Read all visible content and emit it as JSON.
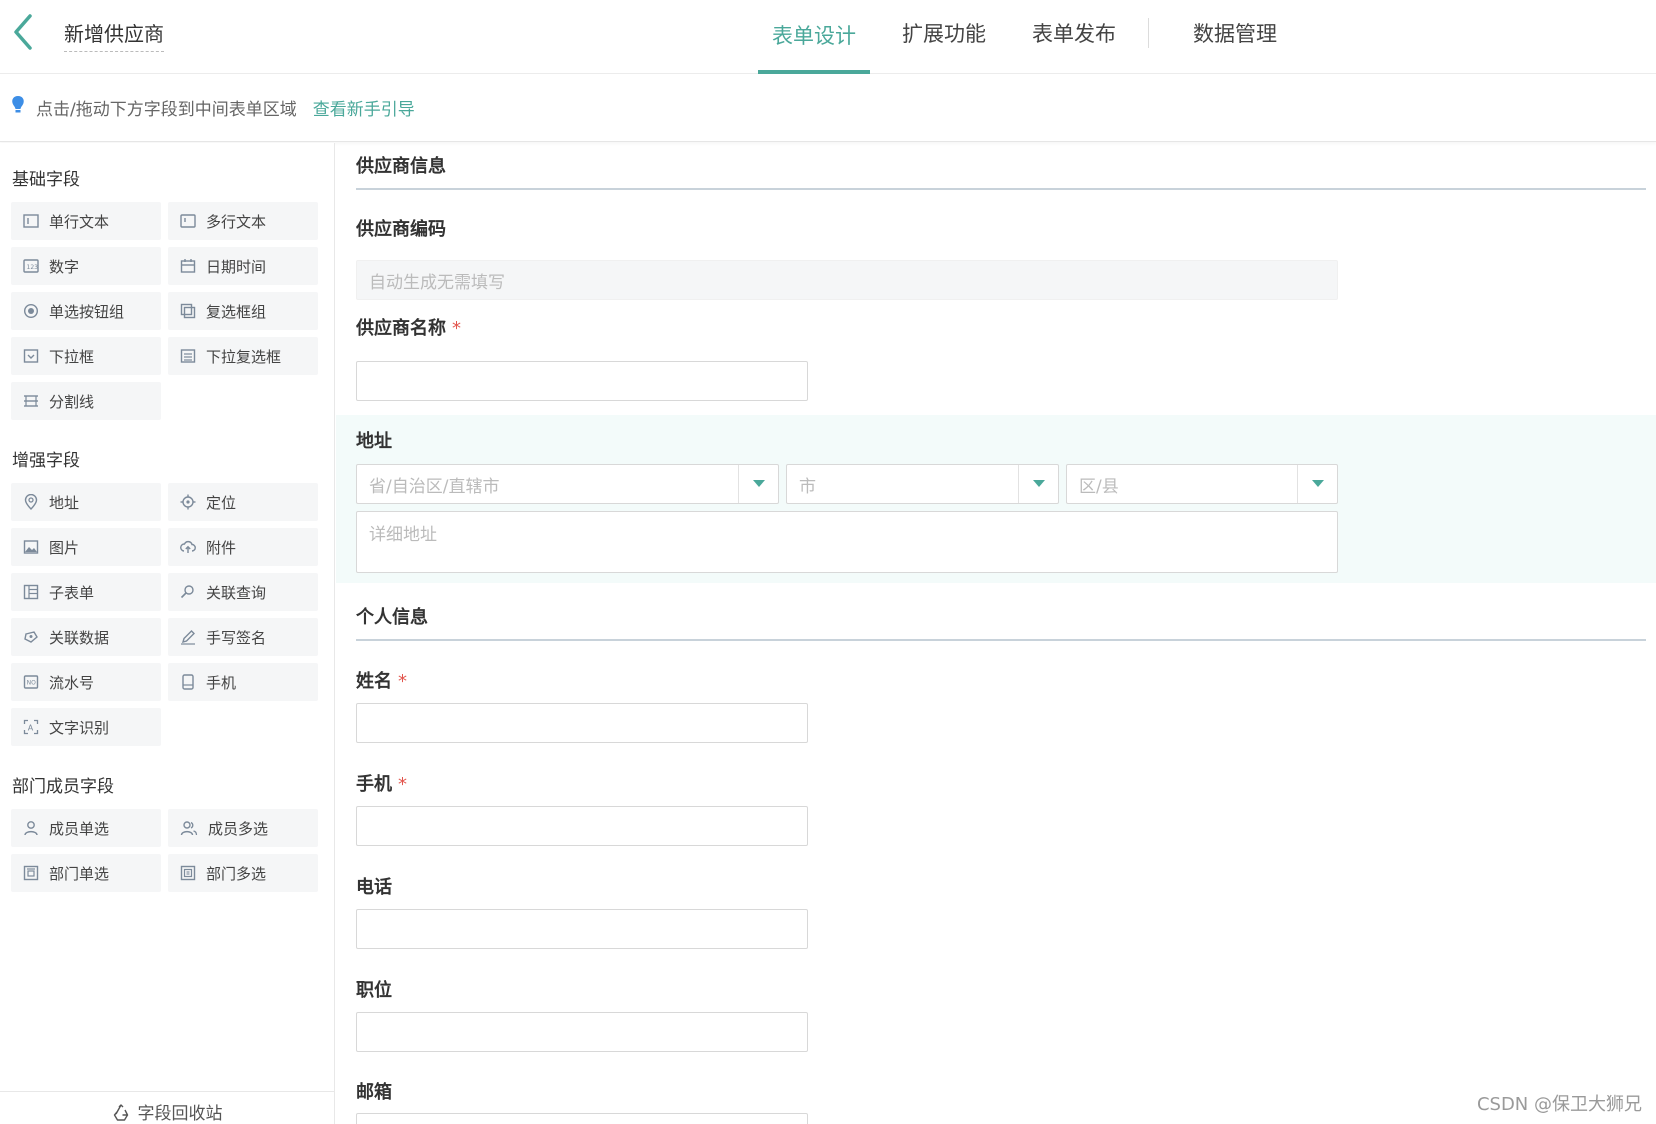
{
  "header": {
    "title": "新增供应商",
    "tabs": [
      {
        "label": "表单设计",
        "active": true
      },
      {
        "label": "扩展功能"
      },
      {
        "label": "表单发布"
      },
      {
        "label": "数据管理"
      }
    ]
  },
  "hint": {
    "text": "点击/拖动下方字段到中间表单区域",
    "link": "查看新手引导"
  },
  "sidebar": {
    "groups": [
      {
        "title": "基础字段",
        "items": [
          "单行文本",
          "多行文本",
          "数字",
          "日期时间",
          "单选按钮组",
          "复选框组",
          "下拉框",
          "下拉复选框",
          "分割线"
        ]
      },
      {
        "title": "增强字段",
        "items": [
          "地址",
          "定位",
          "图片",
          "附件",
          "子表单",
          "关联查询",
          "关联数据",
          "手写签名",
          "流水号",
          "手机",
          "文字识别"
        ]
      },
      {
        "title": "部门成员字段",
        "items": [
          "成员单选",
          "成员多选",
          "部门单选",
          "部门多选"
        ]
      }
    ],
    "recycle": "字段回收站"
  },
  "form": {
    "section1": "供应商信息",
    "code_label": "供应商编码",
    "code_placeholder": "自动生成无需填写",
    "name_label": "供应商名称",
    "address_label": "地址",
    "province_placeholder": "省/自治区/直辖市",
    "city_placeholder": "市",
    "district_placeholder": "区/县",
    "detail_placeholder": "详细地址",
    "section2": "个人信息",
    "person_name_label": "姓名",
    "mobile_label": "手机",
    "phone_label": "电话",
    "position_label": "职位",
    "email_label": "邮箱",
    "required_mark": "*"
  },
  "colors": {
    "accent": "#4aa89a",
    "required": "#e2554d"
  },
  "watermark": "CSDN @保卫大狮兄"
}
